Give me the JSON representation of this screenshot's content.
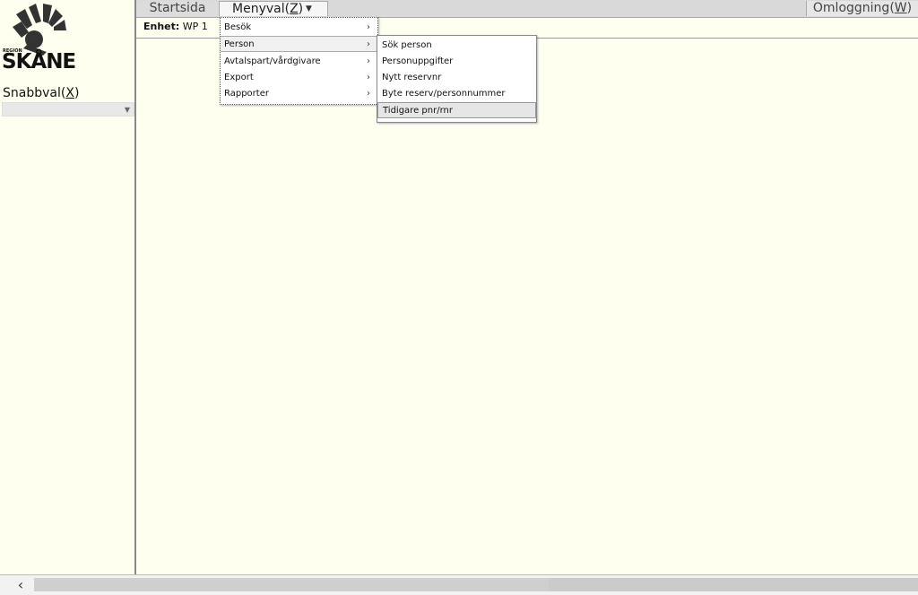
{
  "sidebar": {
    "logo_region": "REGION",
    "logo_text": "SKÅNE",
    "snabbval_label": "Snabbval",
    "snabbval_hotkey": "X",
    "snabbval_value": ""
  },
  "topbar": {
    "tab_start": "Startsida",
    "tab_menu": "Menyval",
    "tab_menu_hotkey": "Z",
    "tab_logout": "Omloggning",
    "tab_logout_hotkey": "W"
  },
  "subheader": {
    "unit_label": "Enhet:",
    "unit_value": "WP 1"
  },
  "menu": {
    "items": [
      {
        "label": "Besök"
      },
      {
        "label": "Person"
      },
      {
        "label": "Avtalspart/vårdgivare"
      },
      {
        "label": "Export"
      },
      {
        "label": "Rapporter"
      }
    ],
    "person_submenu": [
      {
        "label": "Sök person"
      },
      {
        "label": "Personuppgifter"
      },
      {
        "label": "Nytt reservnr"
      },
      {
        "label": "Byte reserv/personnummer"
      },
      {
        "label": "Tidigare pnr/rnr"
      }
    ]
  }
}
